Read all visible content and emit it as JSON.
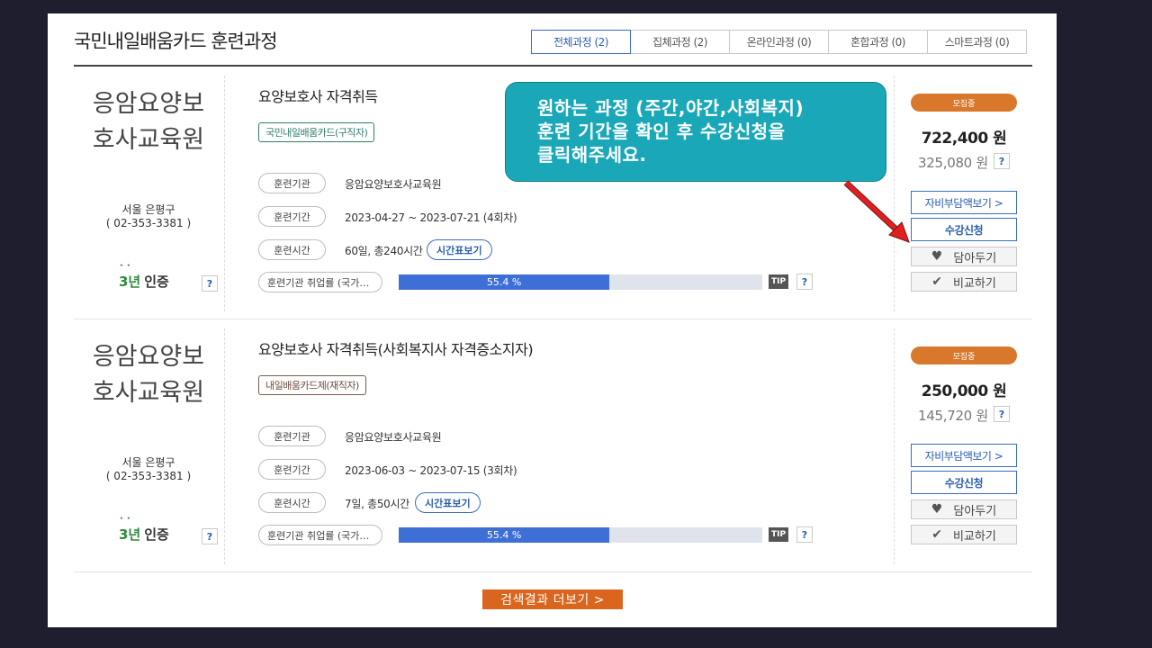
{
  "page": {
    "title": "국민내일배움카드 훈련과정"
  },
  "tabs": [
    {
      "label": "전체과정 (2)",
      "active": true
    },
    {
      "label": "집체과정 (2)",
      "active": false
    },
    {
      "label": "온라인과정 (0)",
      "active": false
    },
    {
      "label": "혼합과정 (0)",
      "active": false
    },
    {
      "label": "스마트과정 (0)",
      "active": false
    }
  ],
  "labels": {
    "org_pill": "훈련기관",
    "period_pill": "훈련기간",
    "hours_pill": "훈련시간",
    "schedule_btn": "시간표보기",
    "emp_pill": "훈련기관 취업률 (국가…",
    "tip": "TIP",
    "question": "?",
    "badge": "모집중",
    "self_pay_btn": "자비부담액보기 >",
    "apply_btn": "수강신청",
    "wish_btn": "담아두기",
    "compare_btn": "비교하기",
    "cert_num": "3년",
    "cert_text": "인증"
  },
  "courses": [
    {
      "org_line1": "응암요양보",
      "org_line2": "호사교육원",
      "location": "서울 은평구",
      "phone": "( 02-353-3381 )",
      "title": "요양보호사 자격취득",
      "tag": "국민내일배움카드(구직자)",
      "org_value": "응암요양보호사교육원",
      "period_value": "2023-04-27 ~ 2023-07-21 (4회차)",
      "hours_value": "60일, 총240시간",
      "employment_rate": "55.4 %",
      "employment_fraction": 0.58,
      "price": "722,400 원",
      "sub_price": "325,080 원"
    },
    {
      "org_line1": "응암요양보",
      "org_line2": "호사교육원",
      "location": "서울 은평구",
      "phone": "( 02-353-3381 )",
      "title": "요양보호사 자격취득(사회복지사 자격증소지자)",
      "tag": "내일배움카드제(재직자)",
      "org_value": "응암요양보호사교육원",
      "period_value": "2023-06-03 ~ 2023-07-15 (3회차)",
      "hours_value": "7일, 총50시간",
      "employment_rate": "55.4 %",
      "employment_fraction": 0.58,
      "price": "250,000 원",
      "sub_price": "145,720 원"
    }
  ],
  "callout": {
    "line1": "원하는 과정 (주간,야간,사회복지)",
    "line2": "훈련 기간을 확인 후 수강신청을",
    "line3": "클릭해주세요."
  },
  "more_btn": "검색결과 더보기 >",
  "colors": {
    "accent": "#3a6cc7",
    "badge": "#d9782a",
    "callout": "#1aa8b8",
    "arrow": "#e02020",
    "more": "#d9651f"
  }
}
